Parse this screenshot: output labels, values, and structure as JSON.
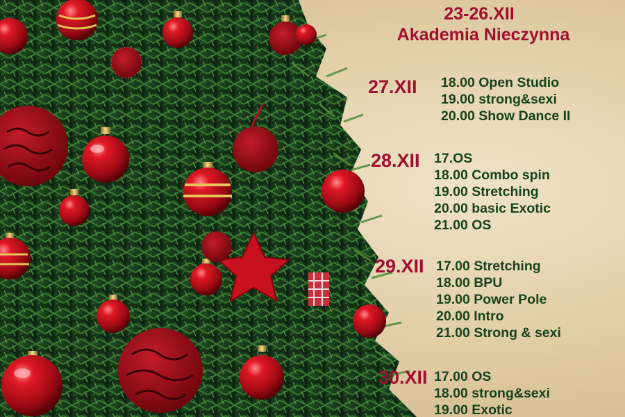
{
  "headline": {
    "dates": "23-26.XII",
    "subtitle": "Akademia Nieczynna"
  },
  "days": [
    {
      "date": "27.XII",
      "slots": [
        "18.00 Open Studio",
        "19.00 strong&sexi",
        "20.00 Show Dance II"
      ]
    },
    {
      "date": "28.XII",
      "slots": [
        "17.OS",
        "18.00 Combo spin",
        "19.00 Stretching",
        "20.00 basic Exotic",
        "21.00 OS"
      ]
    },
    {
      "date": "29.XII",
      "slots": [
        "17.00 Stretching",
        "18.00 BPU",
        "19.00 Power Pole",
        "20.00 Intro",
        "21.00 Strong & sexi"
      ]
    },
    {
      "date": "30.XII",
      "slots": [
        "17.00 OS",
        "18.00 strong&sexi",
        "19.00 Exotic"
      ]
    }
  ],
  "colors": {
    "date_text": "#a01030",
    "schedule_text": "#17421b",
    "background": "#e6d6b4",
    "ornament_red": "#c8101e"
  }
}
